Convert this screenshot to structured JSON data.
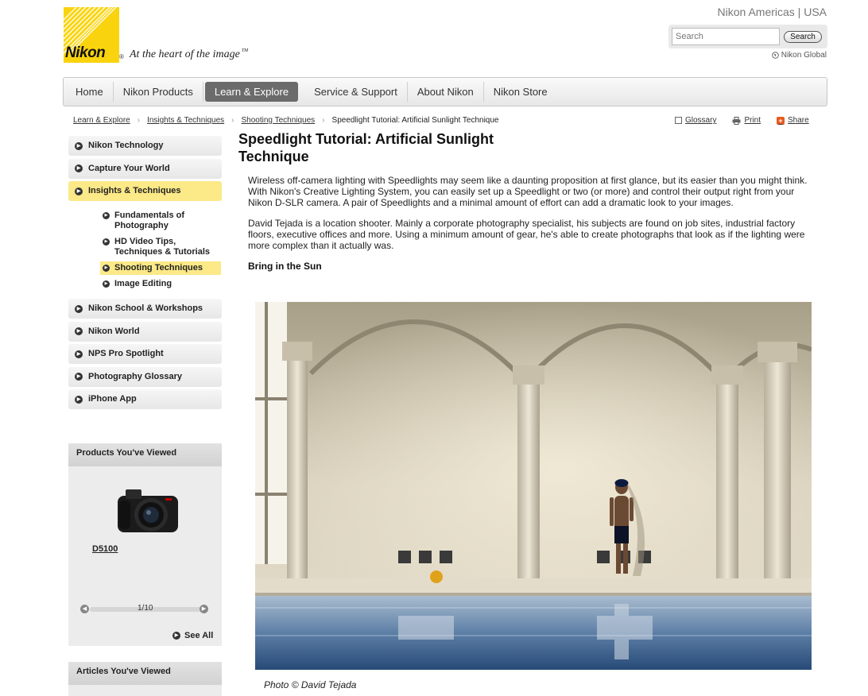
{
  "brand": {
    "logo_text": "Nikon",
    "tagline_pre": "At the heart of the ",
    "tagline_image": "image",
    "trademark": "TM",
    "registered": "®"
  },
  "header": {
    "region": "Nikon Americas | USA",
    "search_placeholder": "Search",
    "search_button": "Search",
    "global_link": "Nikon Global"
  },
  "nav": {
    "items": [
      "Home",
      "Nikon Products",
      "Learn & Explore",
      "Service & Support",
      "About Nikon",
      "Nikon Store"
    ],
    "active": "Learn & Explore"
  },
  "breadcrumb": {
    "items": [
      "Learn & Explore",
      "Insights & Techniques",
      "Shooting Techniques"
    ],
    "current": "Speedlight Tutorial: Artificial Sunlight Technique"
  },
  "tools": {
    "glossary": "Glossary",
    "print": "Print",
    "share": "Share"
  },
  "sidebar": {
    "items": [
      "Nikon Technology",
      "Capture Your World",
      "Insights & Techniques"
    ],
    "sub_items": [
      "Fundamentals of Photography",
      "HD Video Tips, Techniques & Tutorials",
      "Shooting Techniques",
      "Image Editing"
    ],
    "items_after": [
      "Nikon School & Workshops",
      "Nikon World",
      "NPS Pro Spotlight",
      "Photography Glossary",
      "iPhone App"
    ]
  },
  "products_viewed": {
    "heading": "Products You've Viewed",
    "product_name": "D5100",
    "pager": "1/10",
    "see_all": "See All"
  },
  "articles_viewed": {
    "heading": "Articles You've Viewed"
  },
  "article": {
    "title": "Speedlight Tutorial: Artificial Sunlight Technique",
    "paragraph1": "Wireless off-camera lighting with Speedlights may seem like a daunting proposition at first glance, but its easier than you might think. With Nikon's Creative Lighting System, you can easily set up a Speedlight or two (or more) and control their output right from your Nikon D-SLR camera. A pair of Speedlights and a minimal amount of effort can add a dramatic look to your images.",
    "paragraph2": "David Tejada is a location shooter. Mainly a corporate photography specialist, his subjects are found on job sites, industrial factory floors, executive offices and more. Using a minimum amount of gear, he's able to create photographs that look as if the lighting were more complex than it actually was.",
    "subheading": "Bring in the Sun",
    "caption": "Photo © David Tejada"
  },
  "colors": {
    "brand_yellow": "#f9d40e",
    "active_highlight": "#fce987",
    "nav_active": "#6b6b6b"
  }
}
